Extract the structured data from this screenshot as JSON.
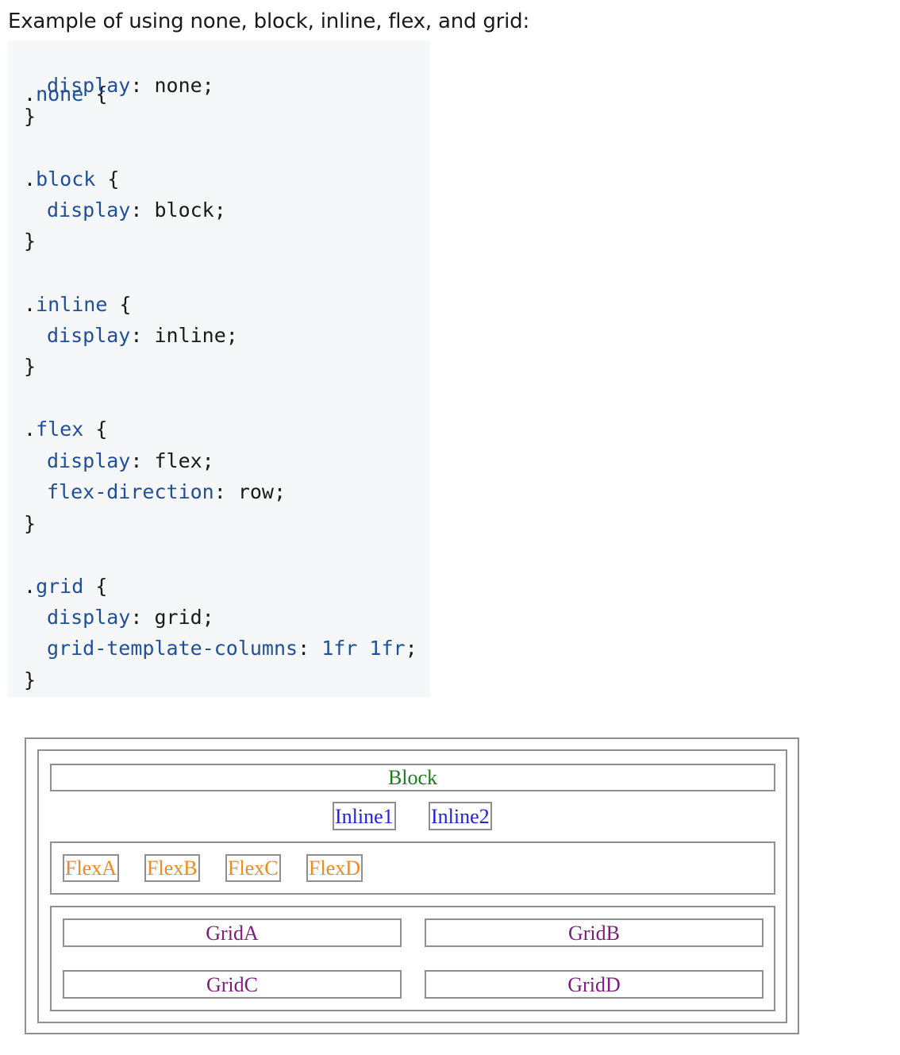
{
  "heading": "Example of using none, block, inline, flex, and grid:",
  "code": {
    "none": {
      "selector": "none",
      "property": "display",
      "value": "none;"
    },
    "block": {
      "selector": "block",
      "property": "display",
      "value": "block;"
    },
    "inline": {
      "selector": "inline",
      "property": "display",
      "value": "inline;"
    },
    "flex": {
      "selector": "flex",
      "property": "display",
      "value": "flex;",
      "property2": "flex-direction",
      "value2": "row;"
    },
    "grid": {
      "selector": "grid",
      "property": "display",
      "value": "grid;",
      "property2": "grid-template-columns",
      "value2a": "1fr",
      "value2b": "1fr",
      "value2end": ";"
    }
  },
  "demo": {
    "block_label": "Block",
    "inline_items": [
      "Inline1",
      "Inline2"
    ],
    "flex_items": [
      "FlexA",
      "FlexB",
      "FlexC",
      "FlexD"
    ],
    "grid_items": [
      "GridA",
      "GridB",
      "GridC",
      "GridD"
    ]
  },
  "colors": {
    "selector": "#1f4f9a",
    "code_background": "#f6f7f8",
    "block": "#1d7d1d",
    "inline": "#2222dd",
    "flex": "#f08a1c",
    "grid": "#7b1f7b"
  }
}
